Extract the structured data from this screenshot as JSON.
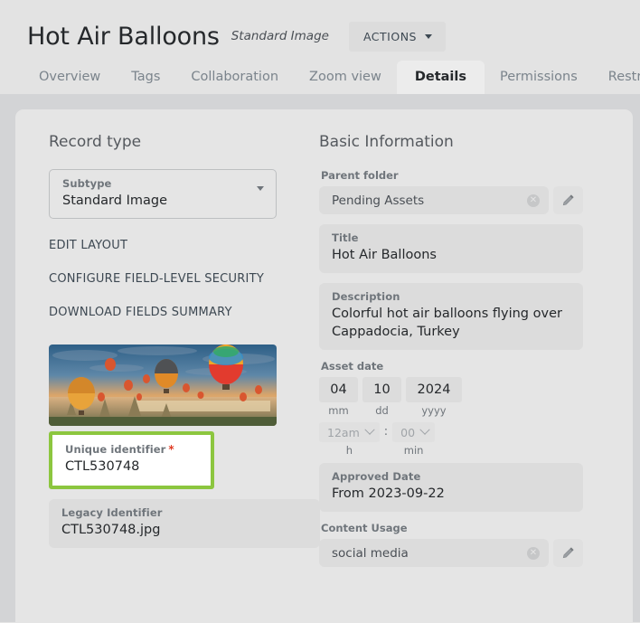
{
  "header": {
    "title": "Hot Air Balloons",
    "subtype_label": "Standard Image",
    "actions_label": "ACTIONS"
  },
  "tabs": [
    {
      "label": "Overview",
      "active": false
    },
    {
      "label": "Tags",
      "active": false
    },
    {
      "label": "Collaboration",
      "active": false
    },
    {
      "label": "Zoom view",
      "active": false
    },
    {
      "label": "Details",
      "active": true
    },
    {
      "label": "Permissions",
      "active": false
    },
    {
      "label": "Restrictions",
      "active": false
    }
  ],
  "left": {
    "heading": "Record type",
    "subtype_field": {
      "label": "Subtype",
      "value": "Standard Image"
    },
    "links": [
      "EDIT LAYOUT",
      "CONFIGURE FIELD-LEVEL SECURITY",
      "DOWNLOAD FIELDS SUMMARY"
    ],
    "unique_identifier": {
      "label": "Unique identifier",
      "required_marker": "*",
      "value": "CTL530748"
    },
    "legacy_identifier": {
      "label": "Legacy Identifier",
      "value": "CTL530748.jpg"
    },
    "highlight_color": "#8cc63f"
  },
  "right": {
    "heading": "Basic Information",
    "parent_folder": {
      "label": "Parent folder",
      "value": "Pending Assets",
      "clear_glyph": "✕"
    },
    "title_field": {
      "label": "Title",
      "value": "Hot Air Balloons"
    },
    "description_field": {
      "label": "Description",
      "value": "Colorful hot air balloons flying over Cappadocia, Turkey"
    },
    "asset_date": {
      "label": "Asset date",
      "mm": "04",
      "dd": "10",
      "yyyy": "2024",
      "mm_sub": "mm",
      "dd_sub": "dd",
      "yyyy_sub": "yyyy",
      "hour": "12am",
      "minute": "00",
      "colon": ":",
      "hour_sub": "h",
      "minute_sub": "min"
    },
    "approved_date": {
      "label": "Approved Date",
      "value": "From 2023-09-22"
    },
    "content_usage": {
      "label": "Content Usage",
      "value": "social media",
      "clear_glyph": "✕"
    }
  }
}
